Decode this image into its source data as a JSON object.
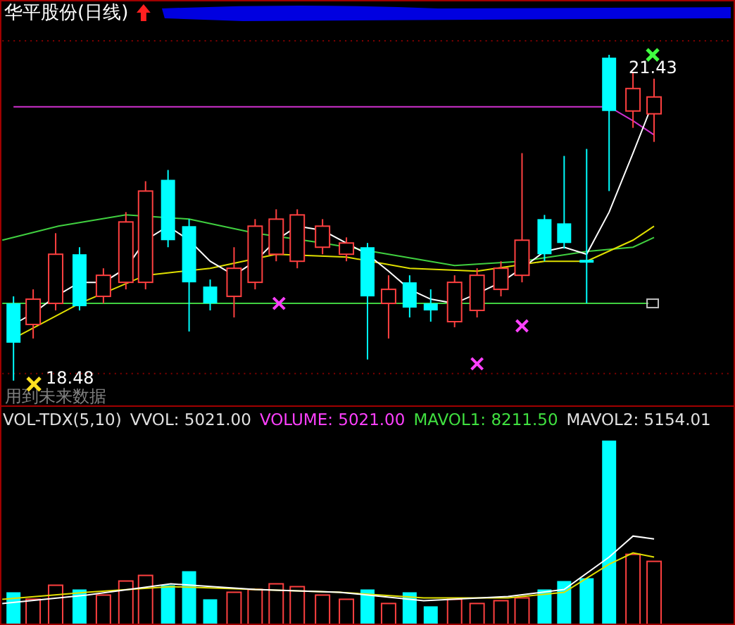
{
  "title": "华平股份(日线)",
  "main_chart": {
    "high_label": "21.43",
    "low_label": "18.48",
    "notice": "用到未来数据"
  },
  "indicator": {
    "name": "VOL-TDX(5,10)",
    "values": [
      {
        "label": "VVOL: 5021.00",
        "color": "#e0e0e0"
      },
      {
        "label": "VOLUME: 5021.00",
        "color": "#ff40ff"
      },
      {
        "label": "MAVOL1: 8211.50",
        "color": "#40e040"
      },
      {
        "label": "MAVOL2: 5154.01",
        "color": "#e0e0e0"
      }
    ]
  }
}
